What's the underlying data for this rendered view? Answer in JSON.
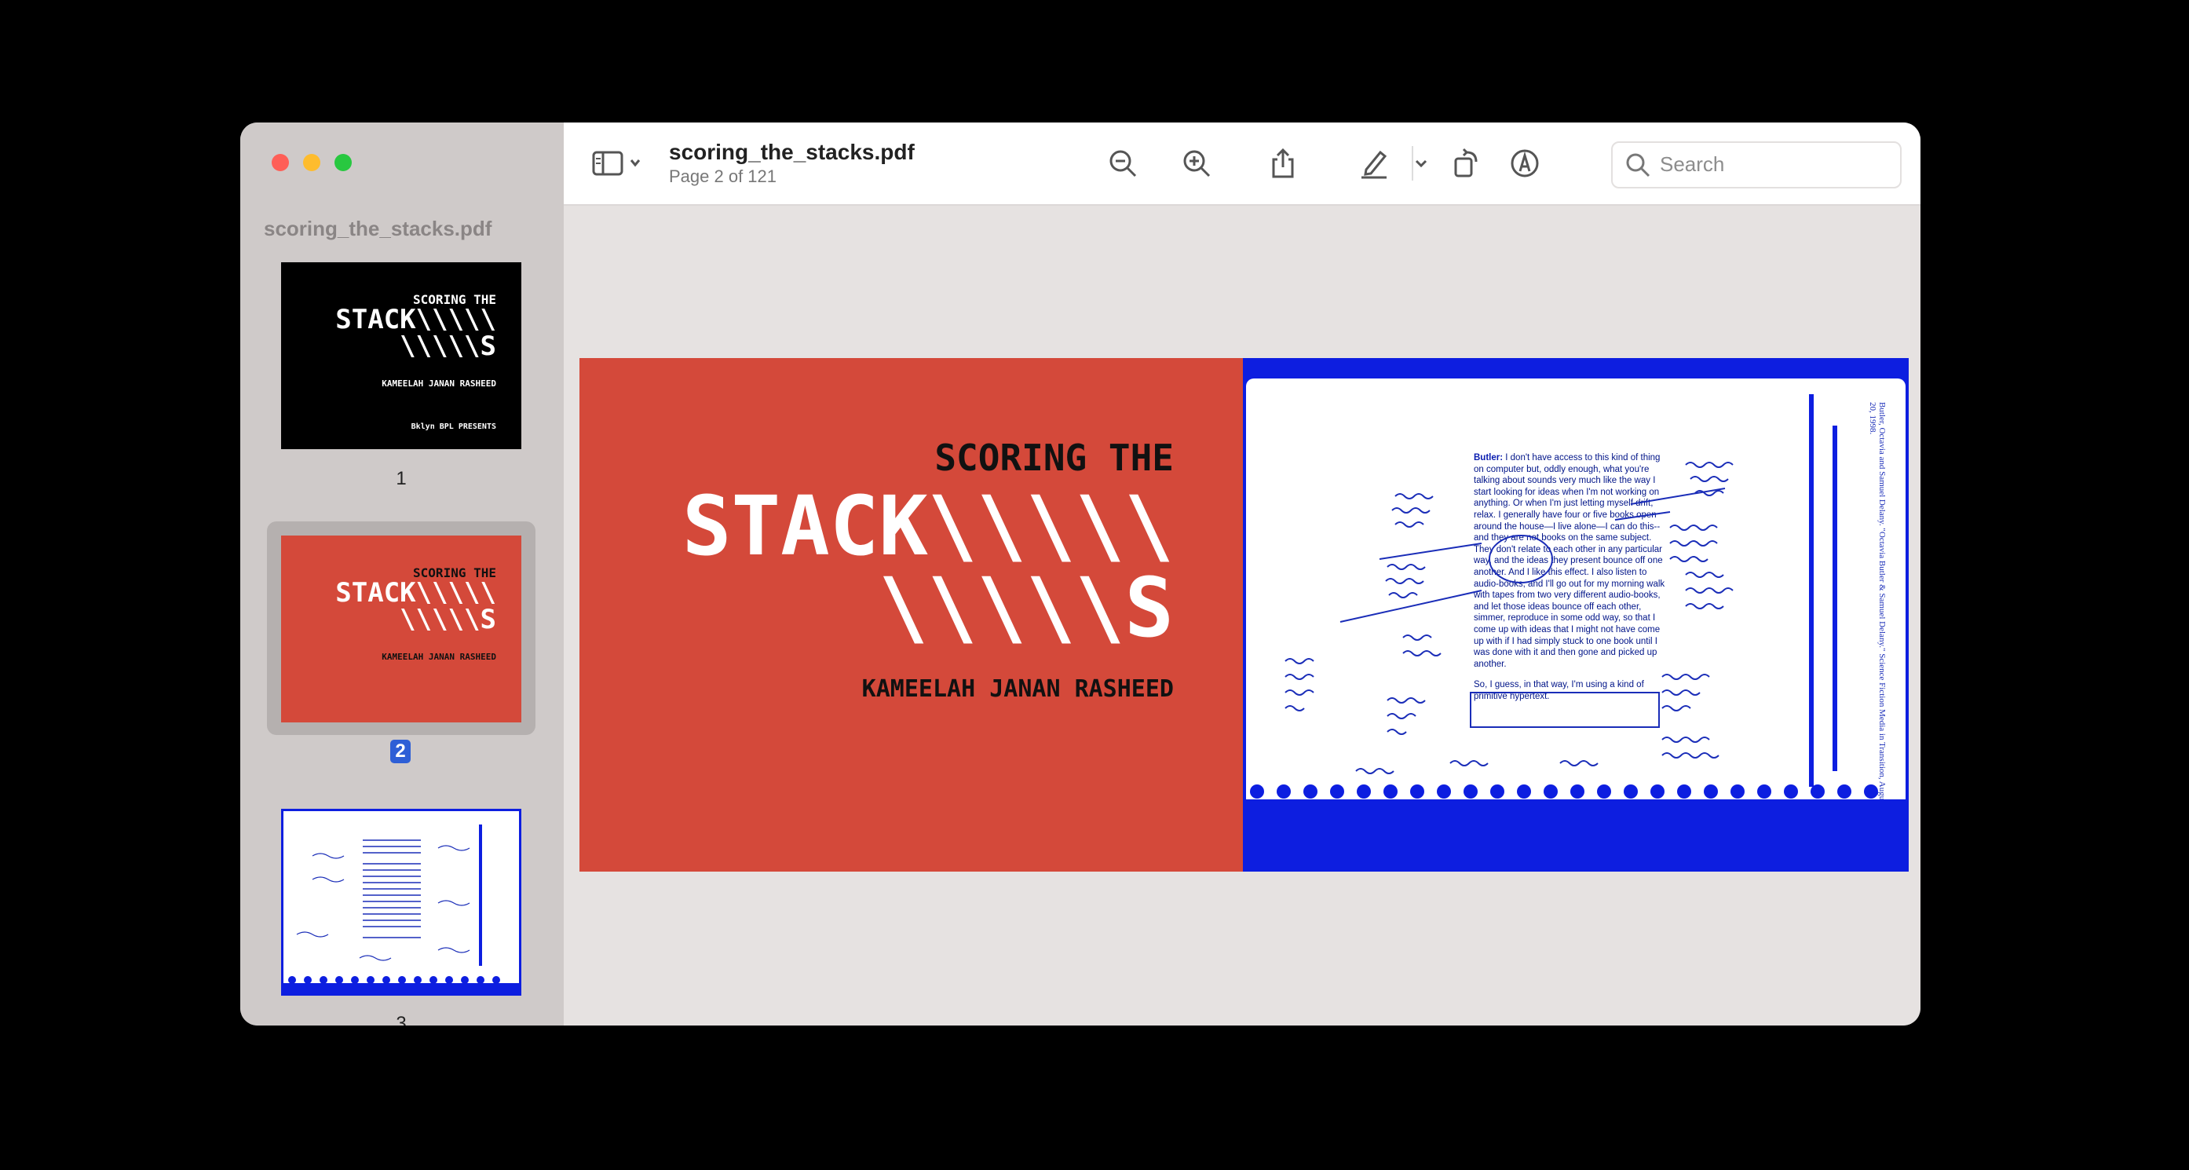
{
  "window": {
    "filename": "scoring_the_stacks.pdf",
    "page_status": "Page 2 of 121"
  },
  "sidebar": {
    "title": "scoring_the_stacks.pdf",
    "pages": [
      {
        "num": "1",
        "line1": "SCORING THE",
        "line2": "STACK\\\\\\\\\\",
        "line3": "\\\\\\\\\\S",
        "author": "KAMEELAH JANAN RASHEED",
        "credit": "Bklyn  BPL PRESENTS"
      },
      {
        "num": "2",
        "line1": "SCORING THE",
        "line2": "STACK\\\\\\\\\\",
        "line3": "\\\\\\\\\\S",
        "author": "KAMEELAH JANAN RASHEED"
      },
      {
        "num": "3"
      }
    ]
  },
  "search": {
    "placeholder": "Search"
  },
  "page": {
    "subtitle": "SCORING THE",
    "title_line1": "STACK\\\\\\\\\\",
    "title_line2": "\\\\\\\\\\S",
    "author": "KAMEELAH JANAN RASHEED",
    "speaker": "Butler:",
    "notes_text": "I don't have access to this kind of thing on computer but, oddly enough, what you're talking about sounds very much like the way I start looking for ideas when I'm not working on anything. Or when I'm just letting myself drift, relax. I generally have four or five books open around the house—I live alone—I can do this--and they are not books on the same subject. They don't relate to each other in any particular way, and the ideas they present bounce off one another. And I like this effect. I also listen to audio-books, and I'll go out for my morning walk with tapes from two very different audio-books, and let those ideas bounce off each other, simmer, reproduce in some odd way, so that I come up with ideas that I might not have come up with if I had simply stuck to one book until I was done with it and then gone and picked up another.",
    "notes_text2": "So, I guess, in that way, I'm using a kind of primitive hypertext.",
    "side_reference": "Butler, Octavia and Samuel Delany. \"Octavia Butler & Samuel Delany.\" Science Fiction Media in Transition, August 20, 1998."
  },
  "colors": {
    "cover_red": "#d4493a",
    "scan_blue": "#0d1ee0",
    "selection_blue": "#2e5fd6"
  }
}
